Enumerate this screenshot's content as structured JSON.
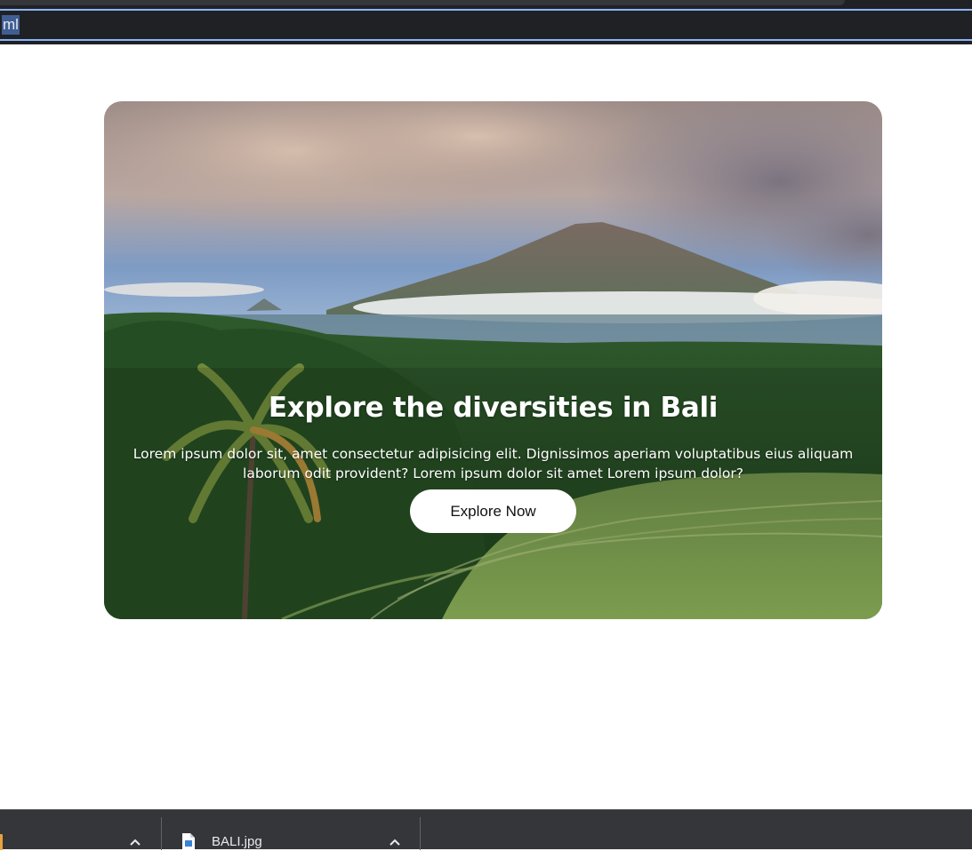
{
  "browser": {
    "url_fragment": "ml",
    "accent": "#8ab4f8"
  },
  "hero": {
    "title": "Explore the diversities in Bali",
    "description": "Lorem ipsum dolor sit, amet consectetur adipisicing elit. Dignissimos aperiam voluptatibus eius aliquam laborum odit provident? Lorem ipsum dolor sit amet Lorem ipsum dolor?",
    "button_label": "Explore Now",
    "background_image": "mountain-rice-terrace-photo"
  },
  "downloads": {
    "items": [
      {
        "name": "",
        "icon": "file-icon",
        "menu_icon": "chevron-up-icon"
      },
      {
        "name": "BALI.jpg",
        "icon": "image-file-icon",
        "menu_icon": "chevron-up-icon"
      }
    ]
  }
}
